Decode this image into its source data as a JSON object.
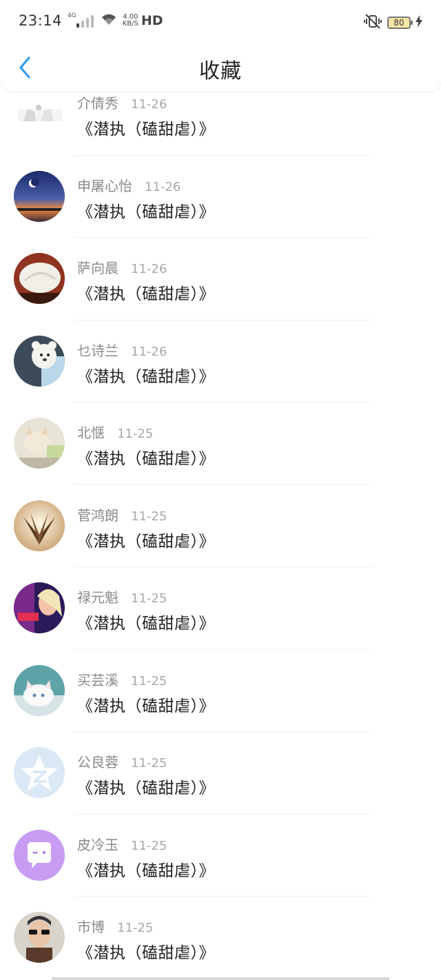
{
  "status_bar": {
    "time": "23:14",
    "network": "4G",
    "speed_value": "4.00",
    "speed_unit": "KB/S",
    "hd": "HD",
    "battery": "80"
  },
  "header": {
    "title": "收藏",
    "back_icon": "chevron-left-icon",
    "accent_color": "#2e9cf5"
  },
  "items": [
    {
      "name": "介倩秀",
      "date": "11-26",
      "title": "《潜执（磕甜虐）》",
      "avatar": "figurine-icon"
    },
    {
      "name": "申屠心怡",
      "date": "11-26",
      "title": "《潜执（磕甜虐）》",
      "avatar": "moon-sunset-photo"
    },
    {
      "name": "萨向晨",
      "date": "11-26",
      "title": "《潜执（磕甜虐）》",
      "avatar": "white-rose-photo"
    },
    {
      "name": "乜诗兰",
      "date": "11-26",
      "title": "《潜执（磕甜虐）》",
      "avatar": "teddy-bear-photo"
    },
    {
      "name": "北惬",
      "date": "11-25",
      "title": "《潜执（磕甜虐）》",
      "avatar": "kitten-photo"
    },
    {
      "name": "菅鸿朗",
      "date": "11-25",
      "title": "《潜执（磕甜虐）》",
      "avatar": "flower-petals-photo"
    },
    {
      "name": "禄元魁",
      "date": "11-25",
      "title": "《潜执（磕甜虐）》",
      "avatar": "anime-girl-photo"
    },
    {
      "name": "买芸溪",
      "date": "11-25",
      "title": "《潜执（磕甜虐）》",
      "avatar": "white-kitten-photo"
    },
    {
      "name": "公良蓉",
      "date": "11-25",
      "title": "《潜执（磕甜虐）》",
      "avatar": "qzone-logo-icon"
    },
    {
      "name": "皮冷玉",
      "date": "11-25",
      "title": "《潜执（磕甜虐）》",
      "avatar": "chat-bubble-icon"
    },
    {
      "name": "市博",
      "date": "11-25",
      "title": "《潜执（磕甜虐）》",
      "avatar": "man-sunglasses-photo"
    }
  ]
}
